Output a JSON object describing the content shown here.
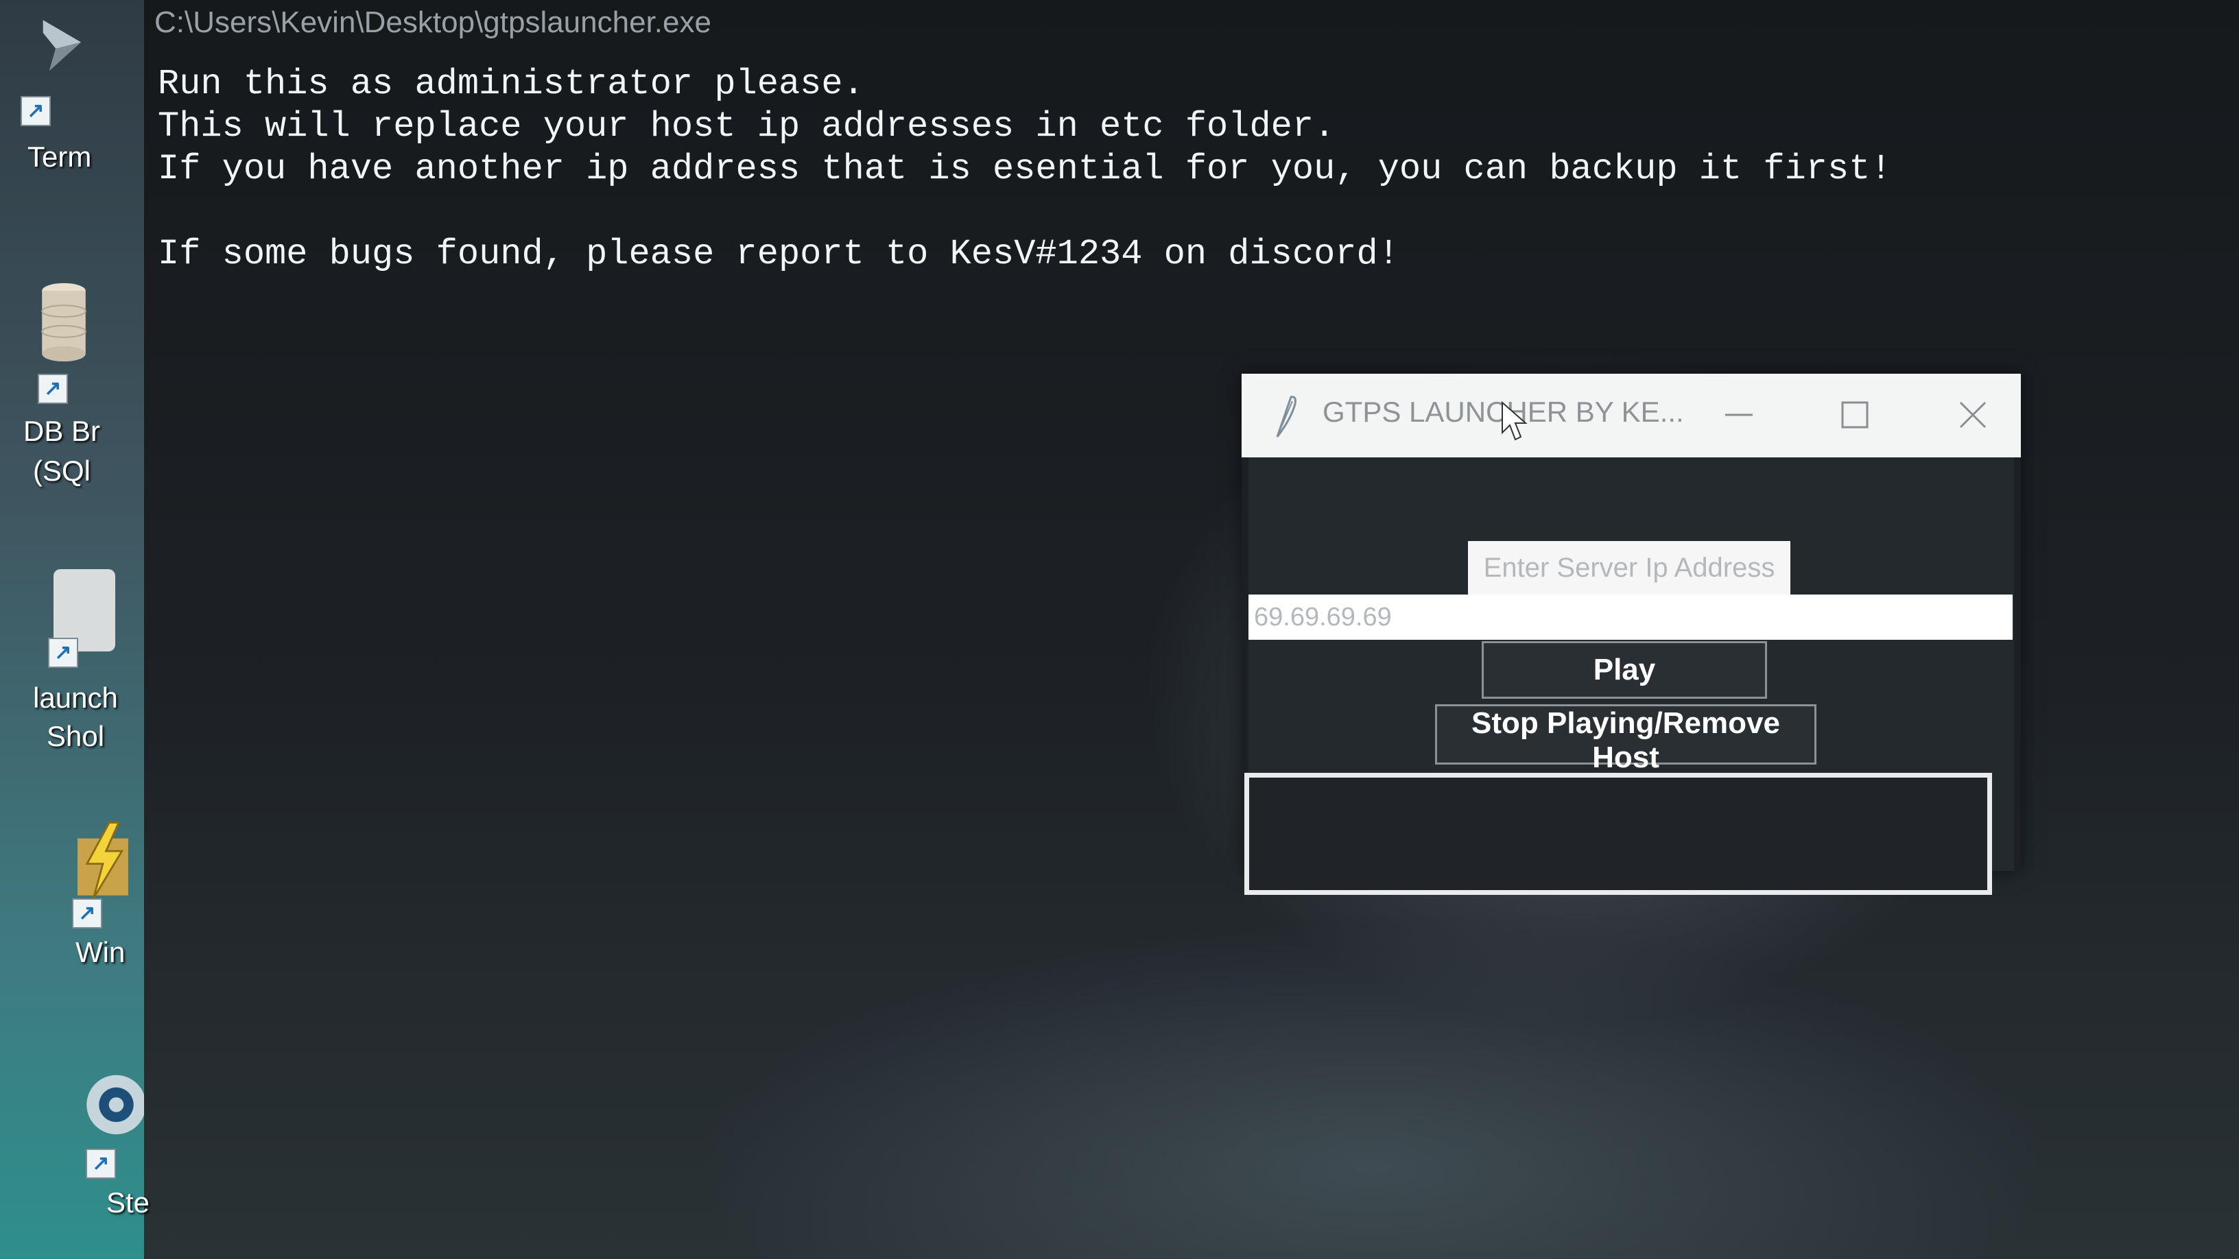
{
  "desktop": {
    "icons": [
      {
        "label": "Term",
        "icon": "terminal-icon"
      },
      {
        "label": "DB Br\n(SQl",
        "icon": "database-icon"
      },
      {
        "label": "launch\nShol",
        "icon": "launcher-shortcut-icon"
      },
      {
        "label": "Win",
        "icon": "winrar-icon"
      },
      {
        "label": "Ste",
        "icon": "steam-icon"
      }
    ]
  },
  "console": {
    "title": "C:\\Users\\Kevin\\Desktop\\gtpslauncher.exe",
    "lines": [
      "Run this as administrator please.",
      "This will replace your host ip addresses in etc folder.",
      "If you have another ip address that is esential for you, you can backup it first!",
      "",
      "If some bugs found, please report to KesV#1234 on discord!"
    ]
  },
  "launcher": {
    "title": "GTPS LAUNCHER BY KE...",
    "title_icon": "feather-icon",
    "ip_label": "Enter Server Ip Address",
    "ip_value": "69.69.69.69",
    "play_label": "Play",
    "stop_label": "Stop Playing/Remove Host"
  },
  "colors": {
    "console_text": "#f2f4f5",
    "titlebar": "#f3f4f4",
    "window_body": "#24292d"
  }
}
